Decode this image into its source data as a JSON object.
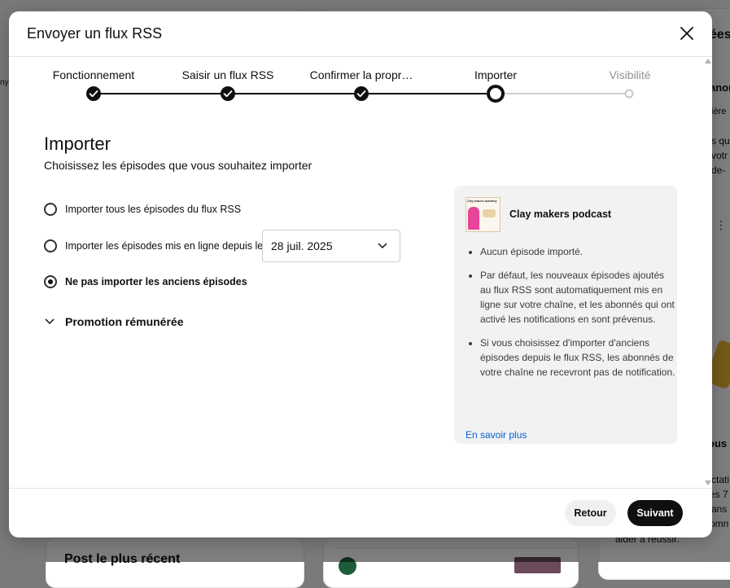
{
  "background": {
    "left_fragment": "ny",
    "right_heading": "ées",
    "right_line1": "anon",
    "right_line2": "ière",
    "right_line3": "s qu",
    "right_line4": "votr",
    "right_line5": "de-",
    "right_line6": "ous a",
    "right_line7": "ctati",
    "right_line8": "es 7 c",
    "right_line9": "ans",
    "right_line10": "omn",
    "right_line11": "aider à réussir.",
    "bottom_left_title": "Post le plus récent"
  },
  "dialog": {
    "title": "Envoyer un flux RSS",
    "steps": [
      {
        "label": "Fonctionnement",
        "state": "done"
      },
      {
        "label": "Saisir un flux RSS",
        "state": "done"
      },
      {
        "label": "Confirmer la propr…",
        "state": "done"
      },
      {
        "label": "Importer",
        "state": "current"
      },
      {
        "label": "Visibilité",
        "state": "upcoming"
      }
    ],
    "heading": "Importer",
    "subtitle": "Choisissez les épisodes que vous souhaitez importer",
    "options": [
      {
        "label": "Importer tous les épisodes du flux RSS",
        "checked": false
      },
      {
        "label": "Importer les épisodes mis en ligne depuis le",
        "checked": false
      },
      {
        "label": "Ne pas importer les anciens épisodes",
        "checked": true
      }
    ],
    "date_value": "28 juil. 2025",
    "promo_label": "Promotion rémunérée",
    "info": {
      "podcast_name": "Clay makers podcast",
      "thumb_text": "Clay makers academy",
      "bullets": [
        "Aucun épisode importé.",
        "Par défaut, les nouveaux épisodes ajoutés au flux RSS sont automatiquement mis en ligne sur votre chaîne, et les abonnés qui ont activé les notifications en sont prévenus.",
        "Si vous choisissez d'importer d'anciens épisodes depuis le flux RSS, les abonnés de votre chaîne ne recevront pas de notification."
      ],
      "learn_more": "En savoir plus"
    },
    "back_label": "Retour",
    "next_label": "Suivant"
  },
  "colors": {
    "accent": "#0f0f0f",
    "link": "#065fd4",
    "panel": "#f2f2f2",
    "disabled": "#909090"
  }
}
